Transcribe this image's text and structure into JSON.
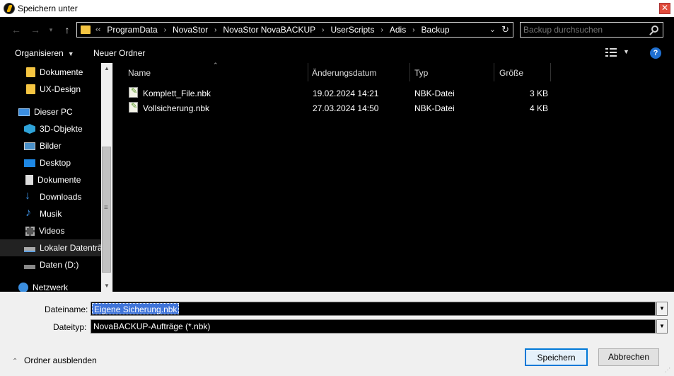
{
  "window": {
    "title": "Speichern unter",
    "close": "✕"
  },
  "address": {
    "overflow": "‹‹",
    "crumbs": [
      "ProgramData",
      "NovaStor",
      "NovaStor NovaBACKUP",
      "UserScripts",
      "Adis",
      "Backup"
    ]
  },
  "search": {
    "placeholder": "Backup durchsuchen"
  },
  "toolbar": {
    "organize": "Organisieren",
    "new_folder": "Neuer Ordner",
    "help": "?"
  },
  "sidebar": {
    "items": [
      {
        "label": "Dokumente",
        "icon": "folder-icon"
      },
      {
        "label": "UX-Design",
        "icon": "folder-icon"
      },
      {
        "label": "Dieser PC",
        "icon": "computer-icon"
      },
      {
        "label": "3D-Objekte",
        "icon": "cube-icon"
      },
      {
        "label": "Bilder",
        "icon": "pictures-icon"
      },
      {
        "label": "Desktop",
        "icon": "desktop-icon"
      },
      {
        "label": "Dokumente",
        "icon": "documents-icon"
      },
      {
        "label": "Downloads",
        "icon": "download-icon"
      },
      {
        "label": "Musik",
        "icon": "music-icon"
      },
      {
        "label": "Videos",
        "icon": "video-icon"
      },
      {
        "label": "Lokaler Datenträ",
        "icon": "local-drive-icon",
        "selected": true
      },
      {
        "label": "Daten (D:)",
        "icon": "drive-icon"
      },
      {
        "label": "Netzwerk",
        "icon": "network-icon"
      }
    ]
  },
  "files": {
    "columns": [
      "Name",
      "Änderungsdatum",
      "Typ",
      "Größe"
    ],
    "rows": [
      {
        "name": "Komplett_File.nbk",
        "date": "19.02.2024 14:21",
        "type": "NBK-Datei",
        "size": "3 KB"
      },
      {
        "name": "Vollsicherung.nbk",
        "date": "27.03.2024 14:50",
        "type": "NBK-Datei",
        "size": "4 KB"
      }
    ]
  },
  "form": {
    "filename_label": "Dateiname:",
    "filename_value": "Eigene Sicherung.nbk",
    "filetype_label": "Dateityp:",
    "filetype_value": "NovaBACKUP-Aufträge (*.nbk)"
  },
  "footer": {
    "hide_folders": "Ordner ausblenden",
    "save": "Speichern",
    "cancel": "Abbrechen"
  },
  "colors": {
    "accent": "#0078d7",
    "selection": "#3f74d9",
    "folder": "#f5c542"
  }
}
